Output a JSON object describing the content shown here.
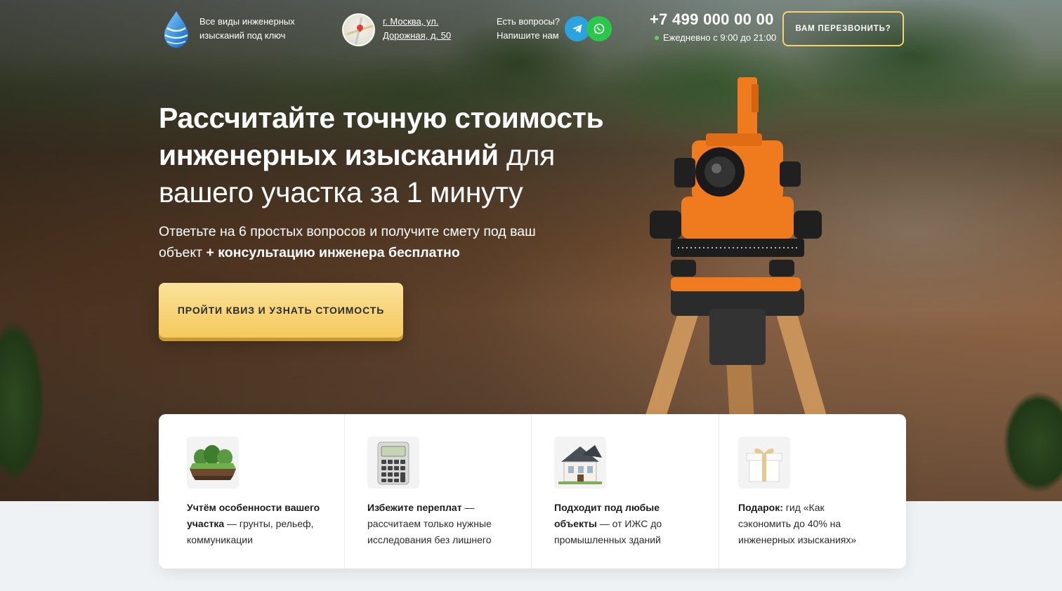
{
  "header": {
    "logo_text": "Все виды инженерных изысканий под ключ",
    "address": "г. Москва, ул. Дорожная, д. 50",
    "contact_line1": "Есть вопросы?",
    "contact_line2": "Напишите нам",
    "telegram_icon": "telegram-icon",
    "whatsapp_icon": "whatsapp-icon",
    "phone": "+7 499 000 00 00",
    "hours": "Ежедневно с 9:00 до 21:00",
    "callback_label": "ВАМ ПЕРЕЗВОНИТЬ?"
  },
  "hero": {
    "title_bold_1": "Рассчитайте точную стоимость",
    "title_bold_2": "инженерных изысканий",
    "title_rest_1": " для",
    "title_rest_2": "вашего участка за 1 минуту",
    "subtitle_normal": "Ответьте на 6 простых вопросов и получите смету под ваш объект ",
    "subtitle_bold": "+ консультацию инженера бесплатно",
    "quiz_button": "ПРОЙТИ КВИЗ И УЗНАТЬ СТОИМОСТЬ"
  },
  "features": [
    {
      "icon": "soil-layer-icon",
      "bold": "Учтём особенности вашего участка",
      "rest": " — грунты, рельеф, коммуникации"
    },
    {
      "icon": "calculator-icon",
      "bold": "Избежите переплат",
      "rest": " — рассчитаем только нужные исследования без лишнего"
    },
    {
      "icon": "house-icon",
      "bold": "Подходит под любые объекты",
      "rest": " — от ИЖС до промышленных зданий"
    },
    {
      "icon": "gift-box-icon",
      "bold": "Подарок:",
      "rest": " гид «Как сэкономить до 40% на инженерных изысканиях»"
    }
  ],
  "colors": {
    "accent_yellow": "#f4c85c",
    "callback_border": "#f1d37b",
    "telegram": "#2ba3df",
    "whatsapp": "#2bc74d",
    "status_green": "#5ad35a"
  }
}
